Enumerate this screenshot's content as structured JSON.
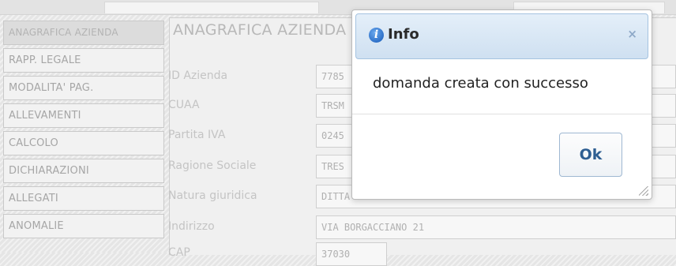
{
  "sidebar": {
    "items": [
      {
        "label": "ANAGRAFICA AZIENDA"
      },
      {
        "label": "RAPP. LEGALE"
      },
      {
        "label": "MODALITA' PAG."
      },
      {
        "label": "ALLEVAMENTI"
      },
      {
        "label": "CALCOLO"
      },
      {
        "label": "DICHIARAZIONI"
      },
      {
        "label": "ALLEGATI"
      },
      {
        "label": "ANOMALIE"
      }
    ]
  },
  "panel": {
    "title": "ANAGRAFICA AZIENDA",
    "fields": [
      {
        "label": "ID Azienda",
        "value": "7785"
      },
      {
        "label": "CUAA",
        "value": "TRSM"
      },
      {
        "label": "Partita IVA",
        "value": "0245"
      },
      {
        "label": "Ragione Sociale",
        "value": "TRES"
      },
      {
        "label": "Natura giuridica",
        "value": "DITTA INDIVIDUALE"
      },
      {
        "label": "Indirizzo",
        "value": "VIA BORGACCIANO 21"
      },
      {
        "label": "CAP",
        "value": "37030"
      }
    ]
  },
  "dialog": {
    "title": "Info",
    "message": "domanda creata con successo",
    "ok_label": "Ok",
    "close_symbol": "×",
    "icon_glyph": "i"
  },
  "colors": {
    "dialog_header": "#cfe0f1",
    "ok_text": "#2e5e92",
    "info_icon": "#1458b8"
  }
}
